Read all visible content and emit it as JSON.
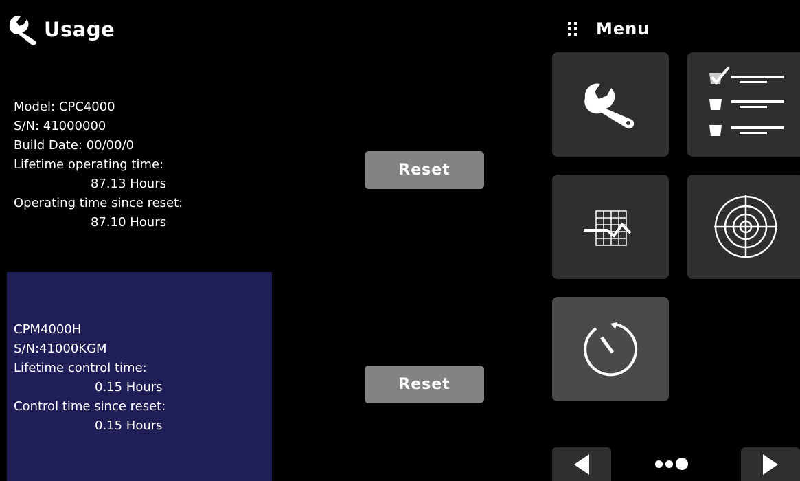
{
  "header": {
    "title": "Usage",
    "icon": "wrench-icon"
  },
  "menu": {
    "label": "Menu",
    "icon": "grid-dots-icon"
  },
  "instrument": {
    "model": "Model: CPC4000",
    "serial": "S/N: 41000000",
    "build_date": "Build Date: 00/00/0",
    "lifetime_label": "Lifetime operating time:",
    "lifetime_value": "87.13 Hours",
    "since_reset_label": "Operating time since reset:",
    "since_reset_value": "87.10 Hours",
    "reset_label": "Reset"
  },
  "controller": {
    "model": "CPM4000H",
    "serial": "S/N:41000KGM",
    "lifetime_label": "Lifetime control time:",
    "lifetime_value": "0.15 Hours",
    "since_reset_label": "Control time since reset:",
    "since_reset_value": "0.15 Hours",
    "reset_label": "Reset",
    "panel_color": "#201e57"
  },
  "tiles": [
    {
      "icon": "wrench-icon"
    },
    {
      "icon": "checklist-icon"
    },
    {
      "icon": "chart-trend-icon"
    },
    {
      "icon": "target-icon"
    },
    {
      "icon": "timer-icon",
      "active": true
    }
  ],
  "pagination": {
    "pages": 3,
    "current": 3
  }
}
